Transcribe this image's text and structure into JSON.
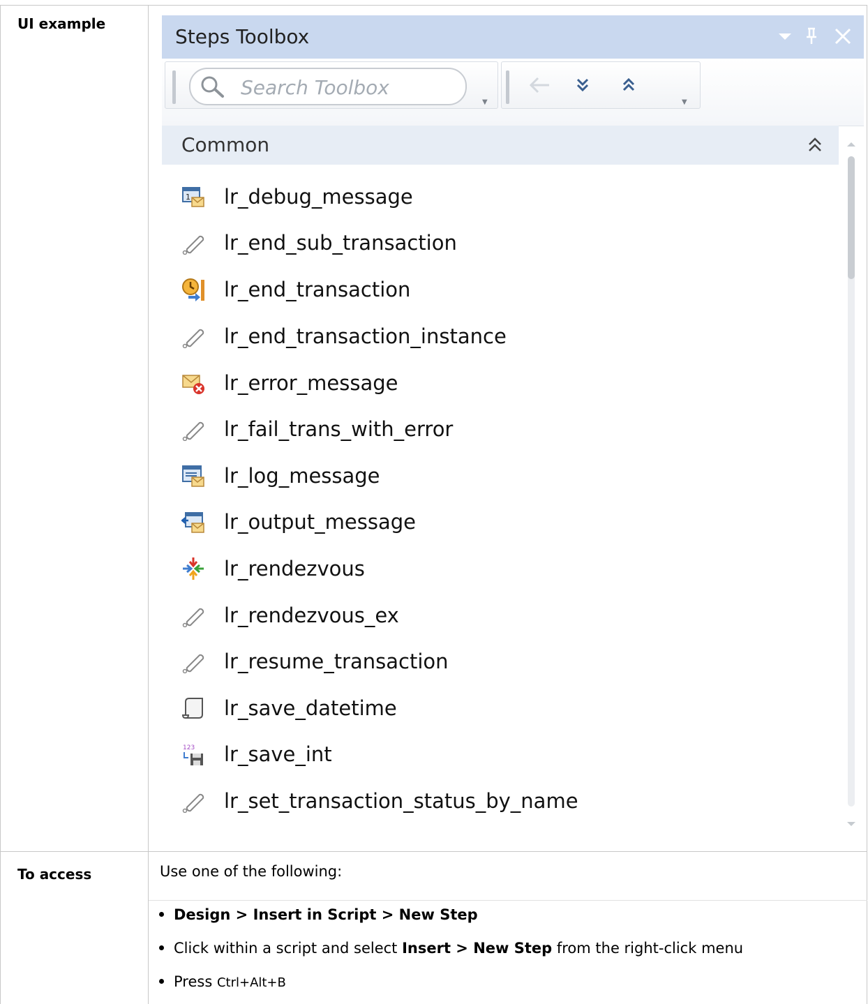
{
  "rows": {
    "ui_example_label": "UI example",
    "to_access_label": "To access"
  },
  "panel": {
    "title": "Steps Toolbox",
    "search_placeholder": "Search Toolbox",
    "category": "Common",
    "items": [
      {
        "label": "lr_debug_message",
        "icon": "debug-message-icon"
      },
      {
        "label": "lr_end_sub_transaction",
        "icon": "function-link-icon"
      },
      {
        "label": "lr_end_transaction",
        "icon": "end-transaction-icon"
      },
      {
        "label": "lr_end_transaction_instance",
        "icon": "function-link-icon"
      },
      {
        "label": "lr_error_message",
        "icon": "error-message-icon"
      },
      {
        "label": "lr_fail_trans_with_error",
        "icon": "function-link-icon"
      },
      {
        "label": "lr_log_message",
        "icon": "log-message-icon"
      },
      {
        "label": "lr_output_message",
        "icon": "output-message-icon"
      },
      {
        "label": "lr_rendezvous",
        "icon": "rendezvous-icon"
      },
      {
        "label": "lr_rendezvous_ex",
        "icon": "function-link-icon"
      },
      {
        "label": "lr_resume_transaction",
        "icon": "function-link-icon"
      },
      {
        "label": "lr_save_datetime",
        "icon": "save-datetime-icon"
      },
      {
        "label": "lr_save_int",
        "icon": "save-int-icon"
      },
      {
        "label": "lr_set_transaction_status_by_name",
        "icon": "function-link-icon"
      }
    ]
  },
  "access": {
    "intro": "Use one of the following:",
    "bullet1": "Design > Insert in Script > New Step",
    "bullet2_pre": "Click within a script and select ",
    "bullet2_bold": "Insert > New Step",
    "bullet2_post": " from the right-click menu",
    "bullet3_pre": "Press ",
    "bullet3_kbd": "Ctrl+Alt+B"
  }
}
